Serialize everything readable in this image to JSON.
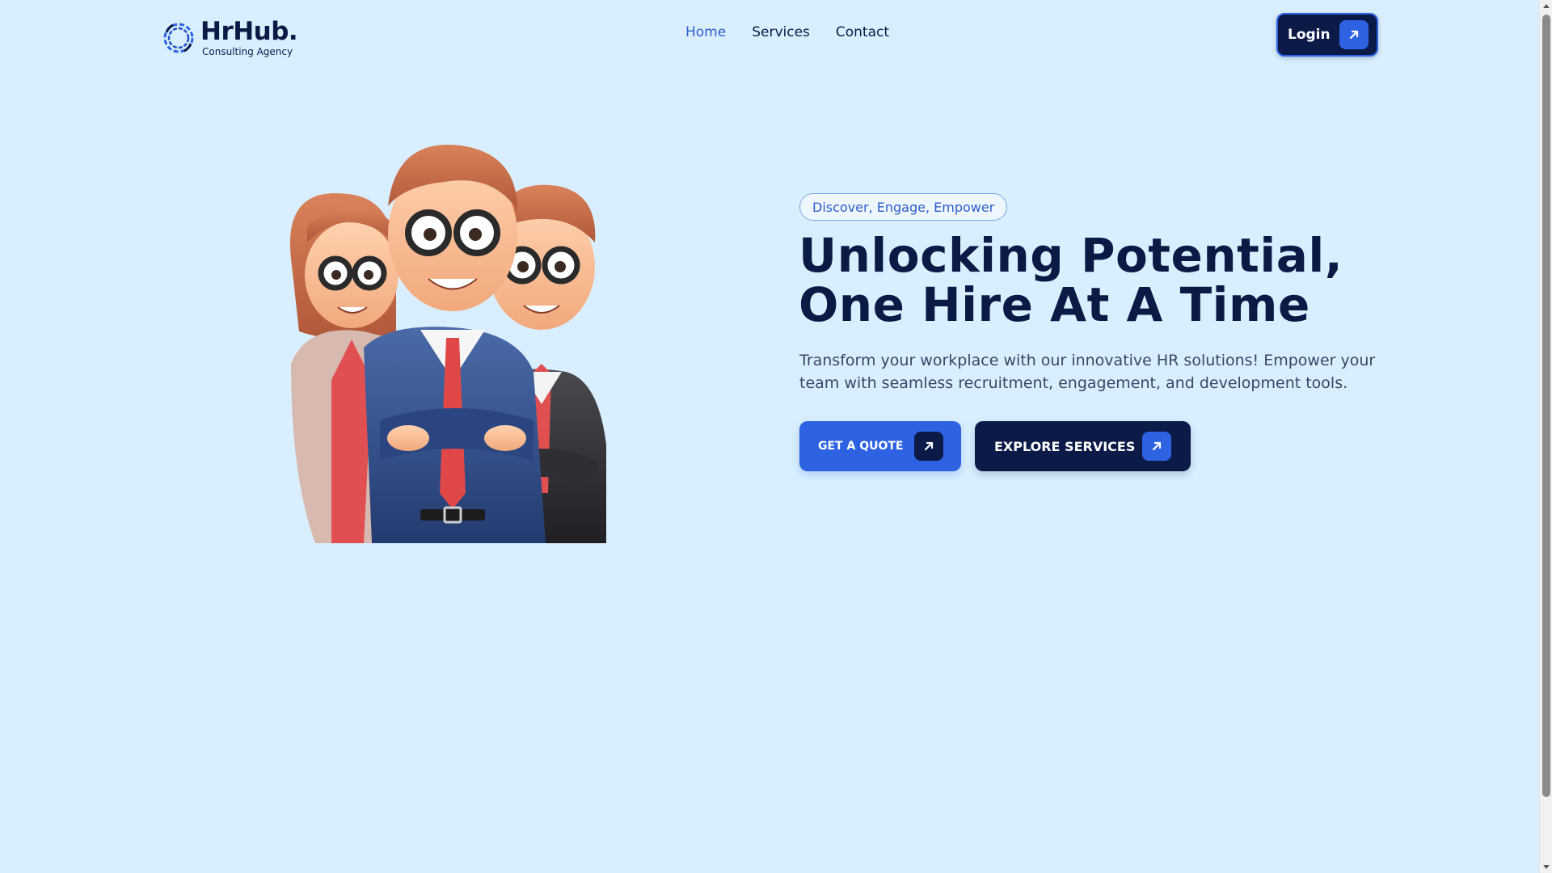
{
  "brand": {
    "name": "HrHub.",
    "tagline": "Consulting Agency"
  },
  "nav": {
    "items": [
      {
        "label": "Home",
        "active": true
      },
      {
        "label": "Services",
        "active": false
      },
      {
        "label": "Contact",
        "active": false
      }
    ]
  },
  "header": {
    "login_label": "Login"
  },
  "hero": {
    "eyebrow": "Discover, Engage, Empower",
    "headline_line1": "Unlocking Potential,",
    "headline_line2": "One Hire At A Time",
    "description": "Transform your workplace with our innovative HR solutions! Empower your team with seamless recruitment, engagement, and development tools.",
    "cta_primary": "GET A QUOTE",
    "cta_secondary": "EXPLORE SERVICES"
  },
  "icons": {
    "logo": "ring-logo-icon",
    "arrow": "arrow-up-right-icon"
  },
  "colors": {
    "background": "#d9efff",
    "navy": "#0b1a45",
    "accent_blue": "#2d63e3",
    "nav_active": "#2c5cc9"
  }
}
